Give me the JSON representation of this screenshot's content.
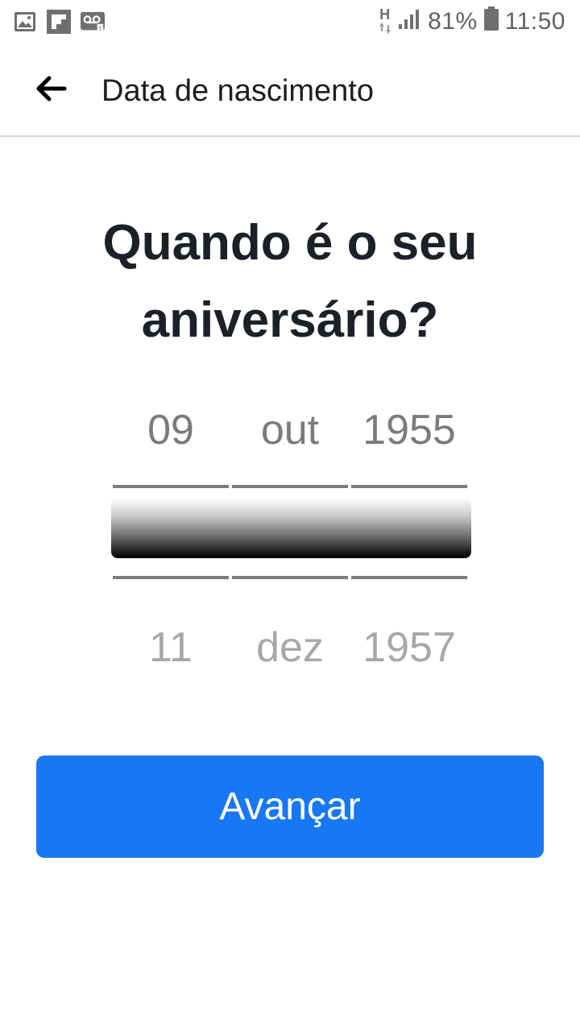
{
  "status_bar": {
    "battery": "81%",
    "time": "11:50",
    "network_type": "H",
    "icons": [
      "gallery-icon",
      "flipboard-icon",
      "voicemail-icon",
      "signal-icon",
      "battery-icon"
    ]
  },
  "header": {
    "title": "Data de nascimento",
    "back_icon": "arrow-left-icon"
  },
  "heading": "Quando é o seu aniversário?",
  "picker": {
    "above": {
      "day": "09",
      "month": "out",
      "year": "1955"
    },
    "below": {
      "day": "11",
      "month": "dez",
      "year": "1957"
    }
  },
  "actions": {
    "next_label": "Avançar"
  },
  "colors": {
    "primary": "#1877f2",
    "heading_text": "#1c2029",
    "picker_text": "#7b7b7b"
  }
}
